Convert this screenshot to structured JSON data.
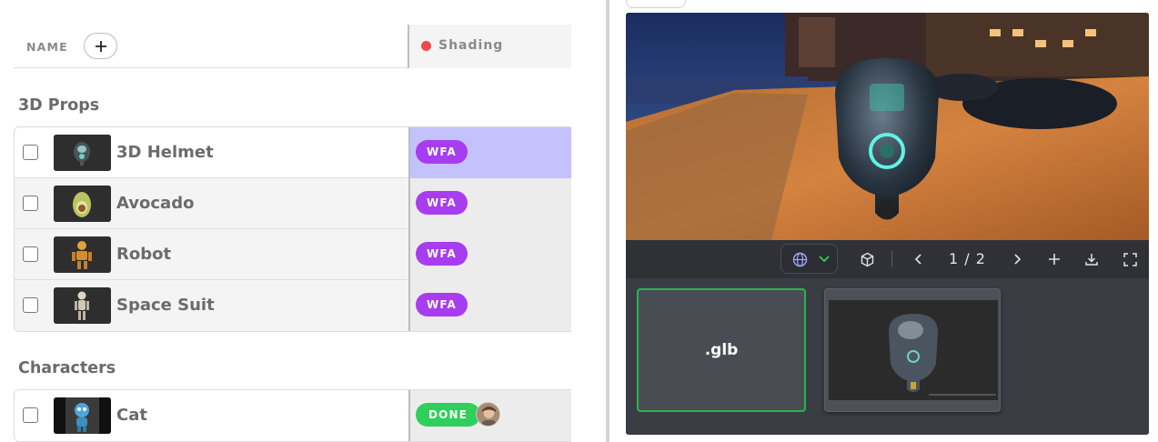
{
  "list_header": {
    "name_label": "NAME",
    "column_title": "Shading",
    "column_status_color": "#ef4a4a"
  },
  "groups": [
    {
      "title": "3D Props",
      "items": [
        {
          "label": "3D Helmet",
          "status": "WFA",
          "thumb": "helmet-thumbnail"
        },
        {
          "label": "Avocado",
          "status": "WFA",
          "thumb": "avocado-thumbnail"
        },
        {
          "label": "Robot",
          "status": "WFA",
          "thumb": "robot-thumbnail"
        },
        {
          "label": "Space Suit",
          "status": "WFA",
          "thumb": "space-suit-thumbnail"
        }
      ]
    },
    {
      "title": "Characters",
      "items": [
        {
          "label": "Cat",
          "status": "DONE",
          "thumb": "cat-thumbnail"
        }
      ]
    }
  ],
  "status_colors": {
    "WFA": "#a83cf0",
    "DONE": "#2ecf5a",
    "selected_cell": "#c4c2fc"
  },
  "viewer": {
    "pager": "1 / 2",
    "thumbnails": [
      {
        "label": ".glb",
        "selected": true
      },
      {
        "label": "",
        "selected": false
      }
    ],
    "icons": [
      "globe-icon",
      "chevron-down-icon",
      "cube-icon",
      "chevron-left-icon",
      "chevron-right-icon",
      "plus-icon",
      "download-icon",
      "fullscreen-icon"
    ]
  }
}
